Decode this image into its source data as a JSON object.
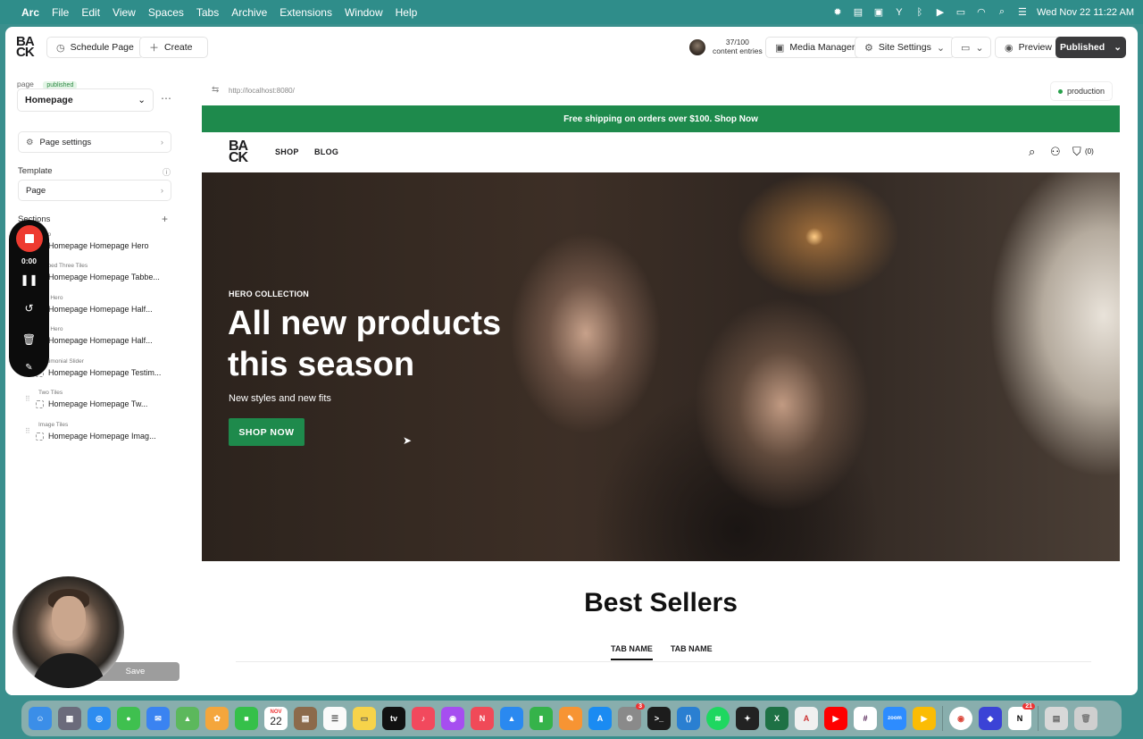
{
  "menubar": {
    "apple": "",
    "items": [
      "Arc",
      "File",
      "Edit",
      "View",
      "Spaces",
      "Tabs",
      "Archive",
      "Extensions",
      "Window",
      "Help"
    ],
    "datetime": "Wed Nov 22  11:22 AM"
  },
  "toolbar": {
    "logo": "BA\nCK",
    "schedule_label": "Schedule Page",
    "create_label": "Create",
    "entries_count": "37/100",
    "entries_label": "content entries",
    "media_label": "Media Manager",
    "settings_label": "Site Settings",
    "preview_label": "Preview",
    "published_label": "Published"
  },
  "sidebar": {
    "page_label": "page",
    "status_badge": "published",
    "page_select": "Homepage",
    "page_settings_label": "Page settings",
    "template_label": "Template",
    "template_value": "Page",
    "sections_label": "Sections",
    "sections": [
      {
        "type": "Hero",
        "name": "Homepage Homepage Hero"
      },
      {
        "type": "Tabbed Three Tiles",
        "name": "Homepage Homepage Tabbe..."
      },
      {
        "type": "Half Hero",
        "name": "Homepage Homepage Half..."
      },
      {
        "type": "Half Hero",
        "name": "Homepage Homepage Half..."
      },
      {
        "type": "Testimonial Slider",
        "name": "Homepage Homepage Testim..."
      },
      {
        "type": "Two Tiles",
        "name": "Homepage Homepage Tw..."
      },
      {
        "type": "Image Tiles",
        "name": "Homepage Homepage Imag..."
      }
    ],
    "save_label": "Save"
  },
  "recorder": {
    "time": "0:00"
  },
  "preview": {
    "url": "http://localhost:8080/",
    "environment": "production",
    "announcement": "Free shipping on orders over $100. Shop Now",
    "nav": {
      "logo": "BA\nCK",
      "links": [
        "SHOP",
        "BLOG"
      ],
      "cart": "(0)"
    },
    "hero": {
      "eyebrow": "HERO COLLECTION",
      "title": "All new products this season",
      "subtitle": "New styles and new fits",
      "cta": "SHOP NOW"
    },
    "bestsellers": {
      "title": "Best Sellers",
      "tabs": [
        "TAB NAME",
        "TAB NAME"
      ]
    }
  },
  "dock": {
    "calendar_month": "NOV",
    "calendar_day": "22",
    "badges": {
      "settings": "3",
      "notion": "21"
    },
    "zoom_label": "zoom"
  },
  "colors": {
    "brand_green": "#1e8a4c",
    "record_red": "#ee3b30",
    "desktop_teal": "#2f8d8a"
  }
}
